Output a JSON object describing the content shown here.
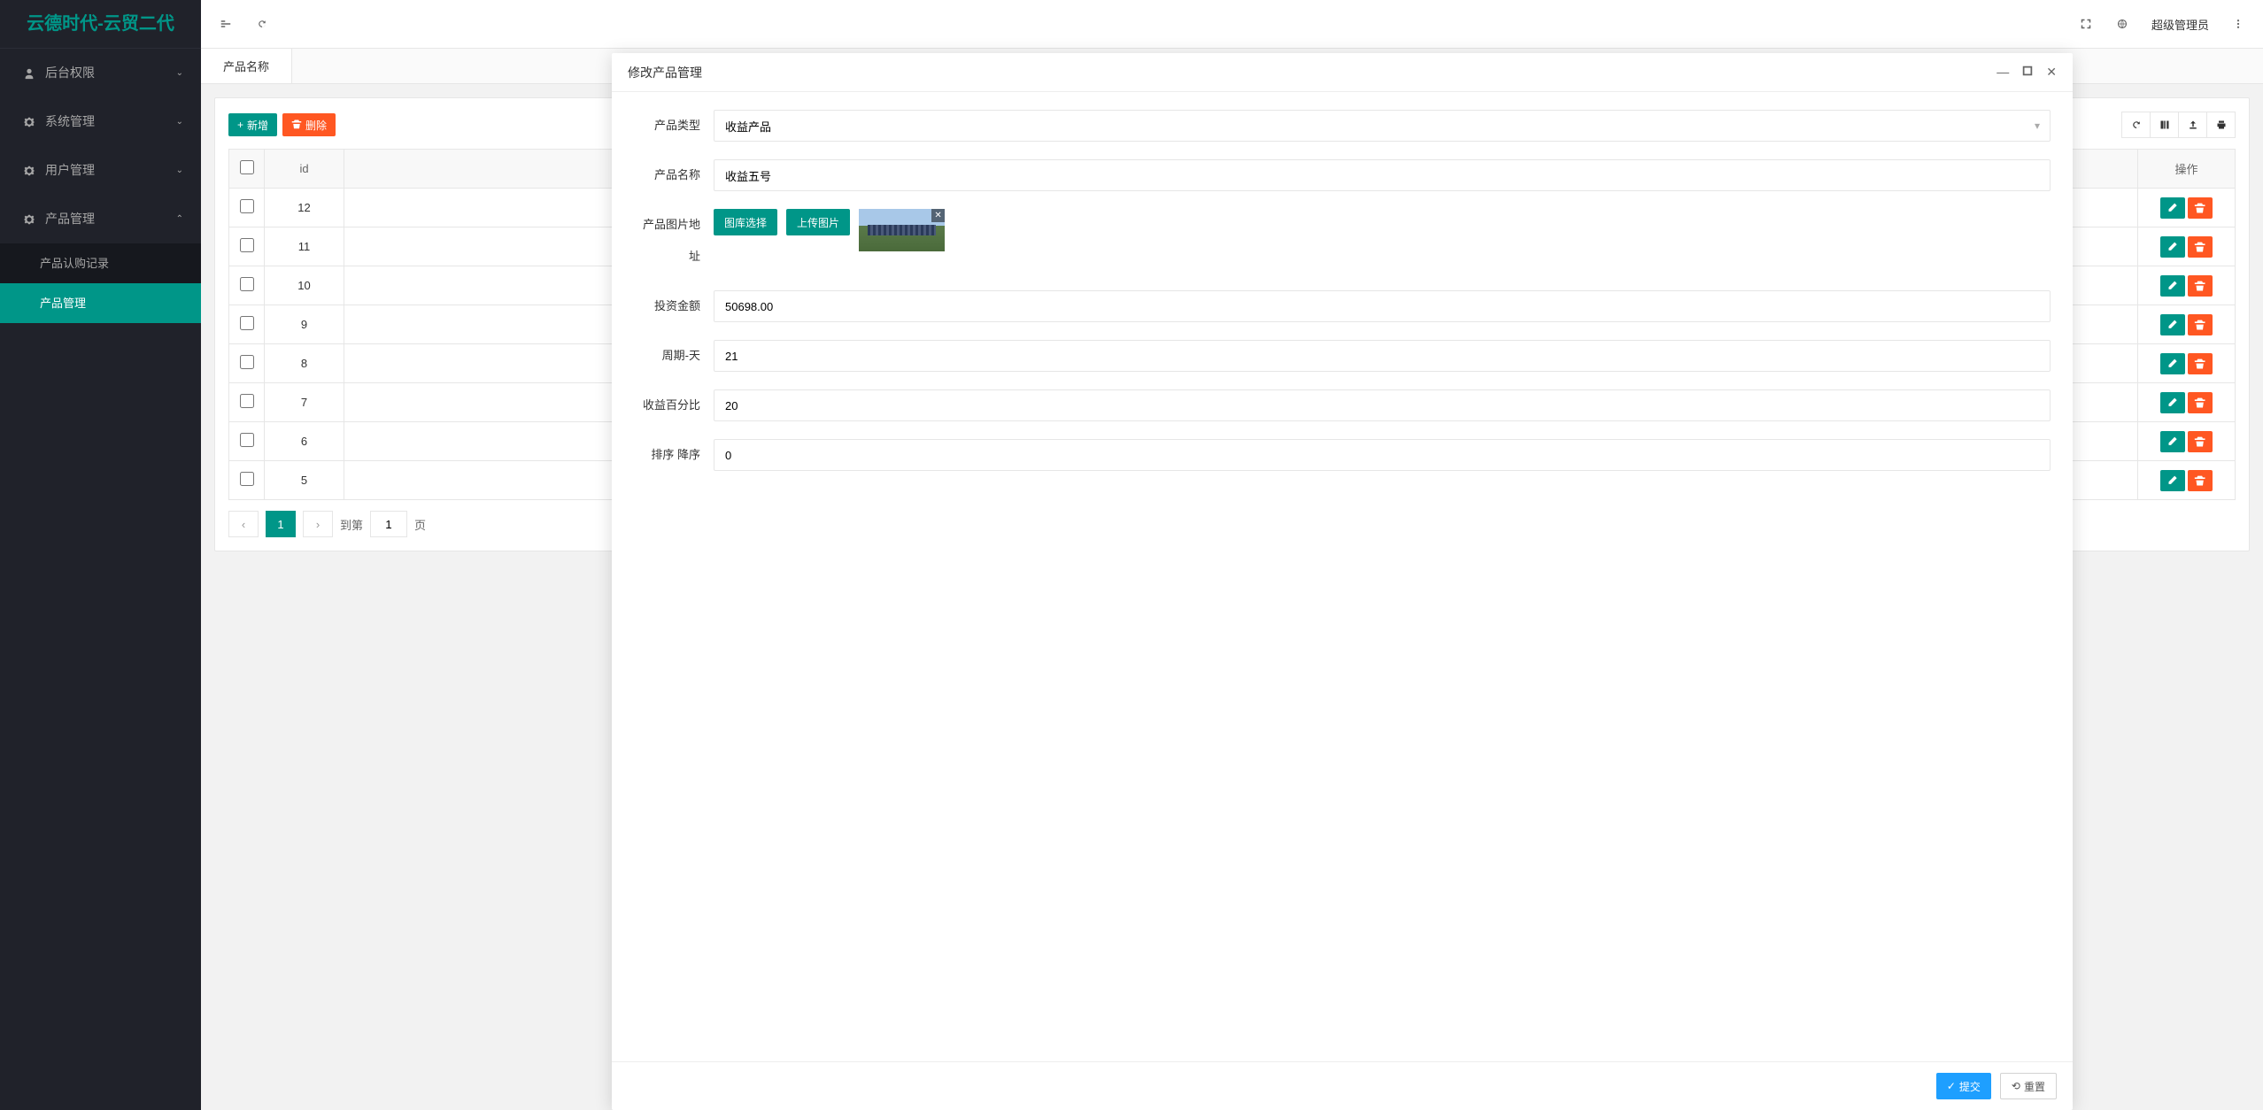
{
  "app_title": "云德时代-云贸二代",
  "header": {
    "user": "超级管理员"
  },
  "sidebar": {
    "items": [
      {
        "label": "后台权限",
        "icon": "user"
      },
      {
        "label": "系统管理",
        "icon": "gear"
      },
      {
        "label": "用户管理",
        "icon": "gear"
      },
      {
        "label": "产品管理",
        "icon": "gear",
        "expanded": true,
        "children": [
          {
            "label": "产品认购记录"
          },
          {
            "label": "产品管理",
            "active": true
          }
        ]
      }
    ]
  },
  "tabs": {
    "active": "产品名称"
  },
  "toolbar": {
    "add": "新增",
    "delete": "删除"
  },
  "table": {
    "headers": {
      "id": "id",
      "op": "操作"
    },
    "rows": [
      {
        "id": "12"
      },
      {
        "id": "11"
      },
      {
        "id": "10"
      },
      {
        "id": "9"
      },
      {
        "id": "8"
      },
      {
        "id": "7"
      },
      {
        "id": "6"
      },
      {
        "id": "5"
      }
    ]
  },
  "pager": {
    "current": "1",
    "goto_label": "到第",
    "goto_value": "1",
    "page_suffix": "页"
  },
  "modal": {
    "title": "修改产品管理",
    "fields": {
      "type": {
        "label": "产品类型",
        "value": "收益产品"
      },
      "name": {
        "label": "产品名称",
        "value": "收益五号"
      },
      "image": {
        "label": "产品图片地址",
        "btn_gallery": "图库选择",
        "btn_upload": "上传图片"
      },
      "amount": {
        "label": "投资金额",
        "value": "50698.00"
      },
      "period": {
        "label": "周期-天",
        "value": "21"
      },
      "percent": {
        "label": "收益百分比",
        "value": "20"
      },
      "sort": {
        "label": "排序 降序",
        "value": "0"
      }
    },
    "footer": {
      "submit": "提交",
      "reset": "重置"
    }
  }
}
